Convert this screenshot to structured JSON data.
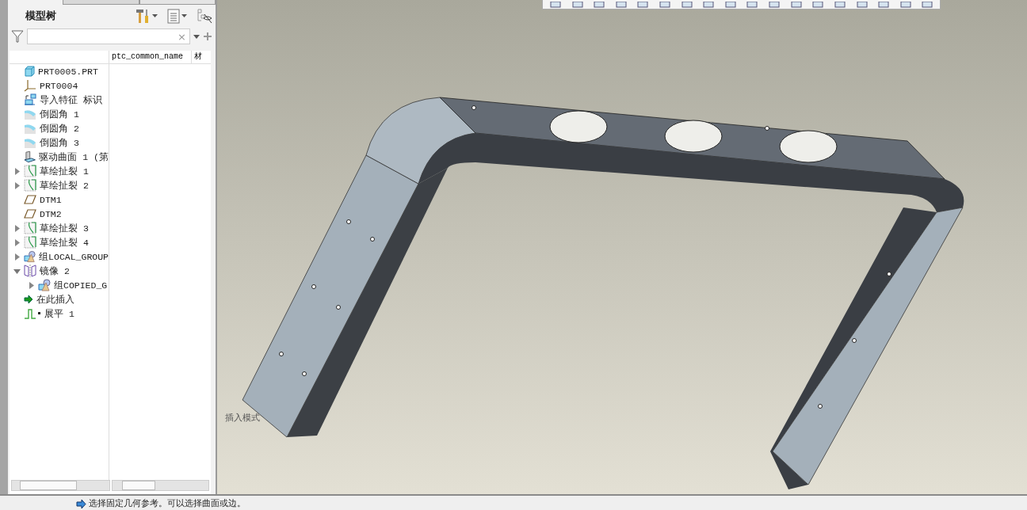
{
  "panel": {
    "title": "模型树",
    "search": {
      "clear": "×"
    }
  },
  "tree": {
    "columns": [
      "ptc_common_name",
      "材"
    ],
    "items": [
      {
        "label": "PRT0005.PRT",
        "kind": "part"
      },
      {
        "label": "PRT0004",
        "kind": "csys"
      },
      {
        "label": "导入特征 标识",
        "kind": "import"
      },
      {
        "label": "倒圆角 1",
        "kind": "round"
      },
      {
        "label": "倒圆角 2",
        "kind": "round"
      },
      {
        "label": "倒圆角 3",
        "kind": "round"
      },
      {
        "label": "驱动曲面 1 (第",
        "kind": "surface"
      },
      {
        "label": "草绘扯裂 1",
        "kind": "rip",
        "expanded": false
      },
      {
        "label": "草绘扯裂 2",
        "kind": "rip",
        "expanded": false
      },
      {
        "label": "DTM1",
        "kind": "plane"
      },
      {
        "label": "DTM2",
        "kind": "plane"
      },
      {
        "label": "草绘扯裂 3",
        "kind": "rip",
        "expanded": false
      },
      {
        "label": "草绘扯裂 4",
        "kind": "rip",
        "expanded": false
      },
      {
        "label": "组LOCAL_GROUP",
        "kind": "group",
        "expanded": false
      },
      {
        "label": "镜像 2",
        "kind": "mirror",
        "expanded": true,
        "children": [
          {
            "label": "组COPIED_G",
            "kind": "group",
            "expanded": false
          }
        ]
      },
      {
        "label": "在此插入",
        "kind": "insert"
      },
      {
        "label": "展平 1",
        "kind": "flatten"
      }
    ]
  },
  "viewport": {
    "mode_label": "插入模式"
  },
  "status_bar": {
    "message": "选择固定几何参考。可以选择曲面或边。"
  }
}
